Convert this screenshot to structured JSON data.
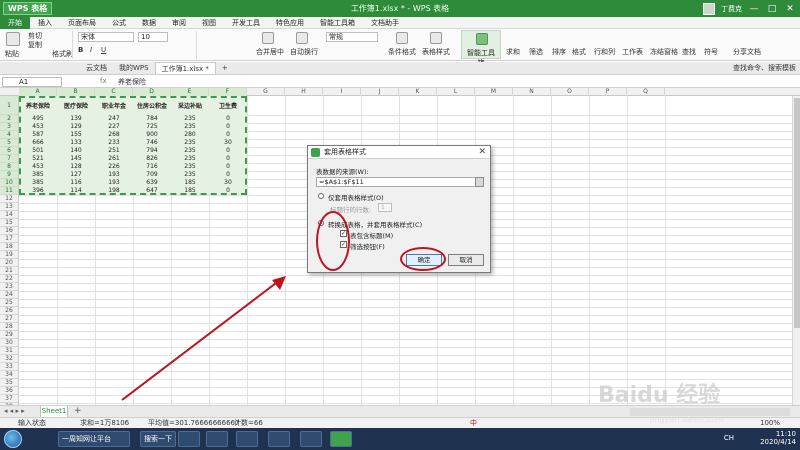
{
  "app": {
    "logo": "WPS 表格",
    "title": "工作簿1.xlsx * - WPS 表格",
    "user": "丁费克",
    "window_controls": [
      "—",
      "□",
      "✕"
    ]
  },
  "menu": [
    "开始",
    "插入",
    "页面布局",
    "公式",
    "数据",
    "审阅",
    "视图",
    "开发工具",
    "特色应用",
    "智能工具箱",
    "文档助手"
  ],
  "ribbon": {
    "paste": "粘贴",
    "cut": "剪切",
    "copy": "复制",
    "format_painter": "格式刷",
    "font_name": "宋体",
    "font_size": "10",
    "merge": "合并居中",
    "wrap": "自动换行",
    "number_format": "常规",
    "conditional": "条件格式",
    "table_style": "表格样式",
    "smart_toolbox": "智能工具箱",
    "sum": "求和",
    "filter": "筛选",
    "sort": "排序",
    "format": "格式",
    "rows_cols": "行和列",
    "worksheet": "工作表",
    "freeze": "冻结窗格",
    "find": "查找",
    "symbol": "符号",
    "share": "分享文档"
  },
  "docbar": {
    "tabs": [
      "云文档",
      "我的WPS",
      "工作簿1.xlsx *"
    ],
    "right": "查找命令、搜索模板"
  },
  "formula": {
    "cell_ref": "A1",
    "fx": "fx",
    "content": "养老保险"
  },
  "grid": {
    "columns": [
      "A",
      "B",
      "C",
      "D",
      "E",
      "F",
      "G",
      "H",
      "I",
      "J",
      "K",
      "L",
      "M",
      "N",
      "O",
      "P",
      "Q"
    ],
    "rows": [
      "1",
      "2",
      "3",
      "4",
      "5",
      "6",
      "7",
      "8",
      "9",
      "10",
      "11",
      "12",
      "13",
      "14",
      "15",
      "16",
      "17",
      "18",
      "19",
      "20",
      "21",
      "22",
      "23",
      "24",
      "25",
      "26",
      "27",
      "28",
      "29",
      "30",
      "31",
      "32",
      "33",
      "34",
      "35",
      "36",
      "37",
      "38"
    ],
    "headers": [
      "养老保险",
      "医疗保险",
      "职业年金",
      "住房公积金",
      "采边补贴",
      "卫生费"
    ],
    "data": [
      [
        "495",
        "139",
        "247",
        "784",
        "235",
        "0"
      ],
      [
        "453",
        "129",
        "227",
        "725",
        "235",
        "0"
      ],
      [
        "587",
        "155",
        "268",
        "900",
        "280",
        "0"
      ],
      [
        "666",
        "133",
        "233",
        "746",
        "235",
        "30"
      ],
      [
        "501",
        "140",
        "251",
        "794",
        "235",
        "0"
      ],
      [
        "521",
        "145",
        "261",
        "826",
        "235",
        "0"
      ],
      [
        "453",
        "128",
        "226",
        "716",
        "235",
        "0"
      ],
      [
        "385",
        "127",
        "193",
        "709",
        "235",
        "0"
      ],
      [
        "385",
        "116",
        "193",
        "639",
        "185",
        "30"
      ],
      [
        "396",
        "114",
        "198",
        "647",
        "185",
        "0"
      ]
    ]
  },
  "dialog": {
    "title": "套用表格样式",
    "source_label": "表数据的来源(W):",
    "source_value": "=$A$1:$F$11",
    "option_style_only": "仅套用表格样式(O)",
    "header_rows_label": "标题行的行数:",
    "header_rows_value": "1",
    "option_convert": "转换成表格，并套用表格样式(C)",
    "check_header": "表包含标题(M)",
    "check_filter": "筛选按钮(F)",
    "check_mark": "✓",
    "ok": "确定",
    "cancel": "取消",
    "close": "✕"
  },
  "sheets": {
    "nav": "◂ ◂ ▸ ▸",
    "active": "Sheet1",
    "add": "+"
  },
  "status": {
    "mode": "输入状态",
    "sum": "求和=1万8106",
    "average": "平均值=301.76666666667",
    "count": "计数=66",
    "zoom": "100%"
  },
  "taskbar": {
    "item1": "一周知网让平台",
    "item2": "搜索一下",
    "clock_time": "11:10",
    "clock_date": "2020/4/14",
    "tray_lang": "CH",
    "ime": "中"
  },
  "watermark": {
    "brand": "Baidu 经验",
    "url": "jingyan.baidu.com"
  },
  "colors": {
    "accent": "#2e8b3a",
    "annotation": "#c0121b",
    "selection": "#e6f2e1"
  }
}
